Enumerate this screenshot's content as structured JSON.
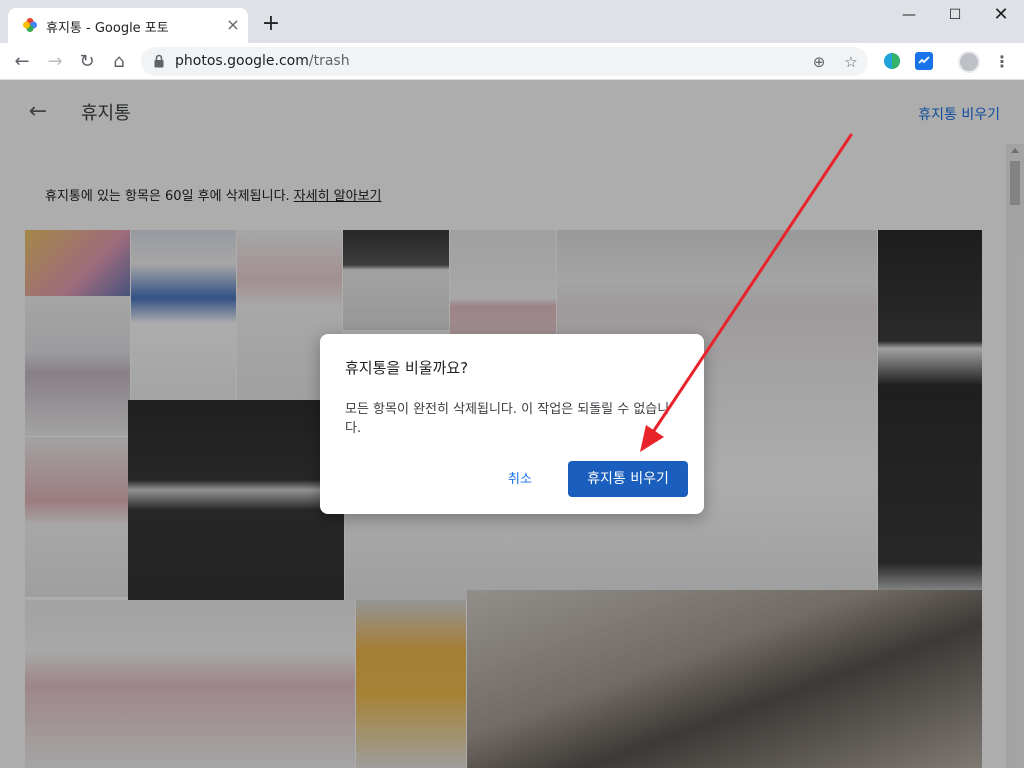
{
  "browser": {
    "tab_title": "휴지통 - Google 포토",
    "tab_close": "×",
    "new_tab": "+",
    "window_min": "—",
    "window_max": "☐",
    "window_close": "✕",
    "url_host": "photos.google.com",
    "url_path": "/trash",
    "nav_back": "←",
    "nav_forward": "→",
    "nav_reload": "↻",
    "nav_home": "⌂",
    "omni_add": "⊕",
    "omni_star": "☆",
    "menu": "⋮"
  },
  "page": {
    "back": "←",
    "title": "휴지통",
    "empty_trash_link": "휴지통 비우기",
    "info_text": "휴지통에 있는 항목은 60일 후에 삭제됩니다.",
    "info_link": "자세히 알아보기"
  },
  "dialog": {
    "title": "휴지통을 비울까요?",
    "body": "모든 항목이 완전히 삭제됩니다. 이 작업은 되돌릴 수 없습니다.",
    "cancel_label": "취소",
    "confirm_label": "휴지통 비우기"
  },
  "colors": {
    "accent": "#1a73e8",
    "confirm_button": "#1a5fbd",
    "annotation_arrow": "#e8232a"
  }
}
